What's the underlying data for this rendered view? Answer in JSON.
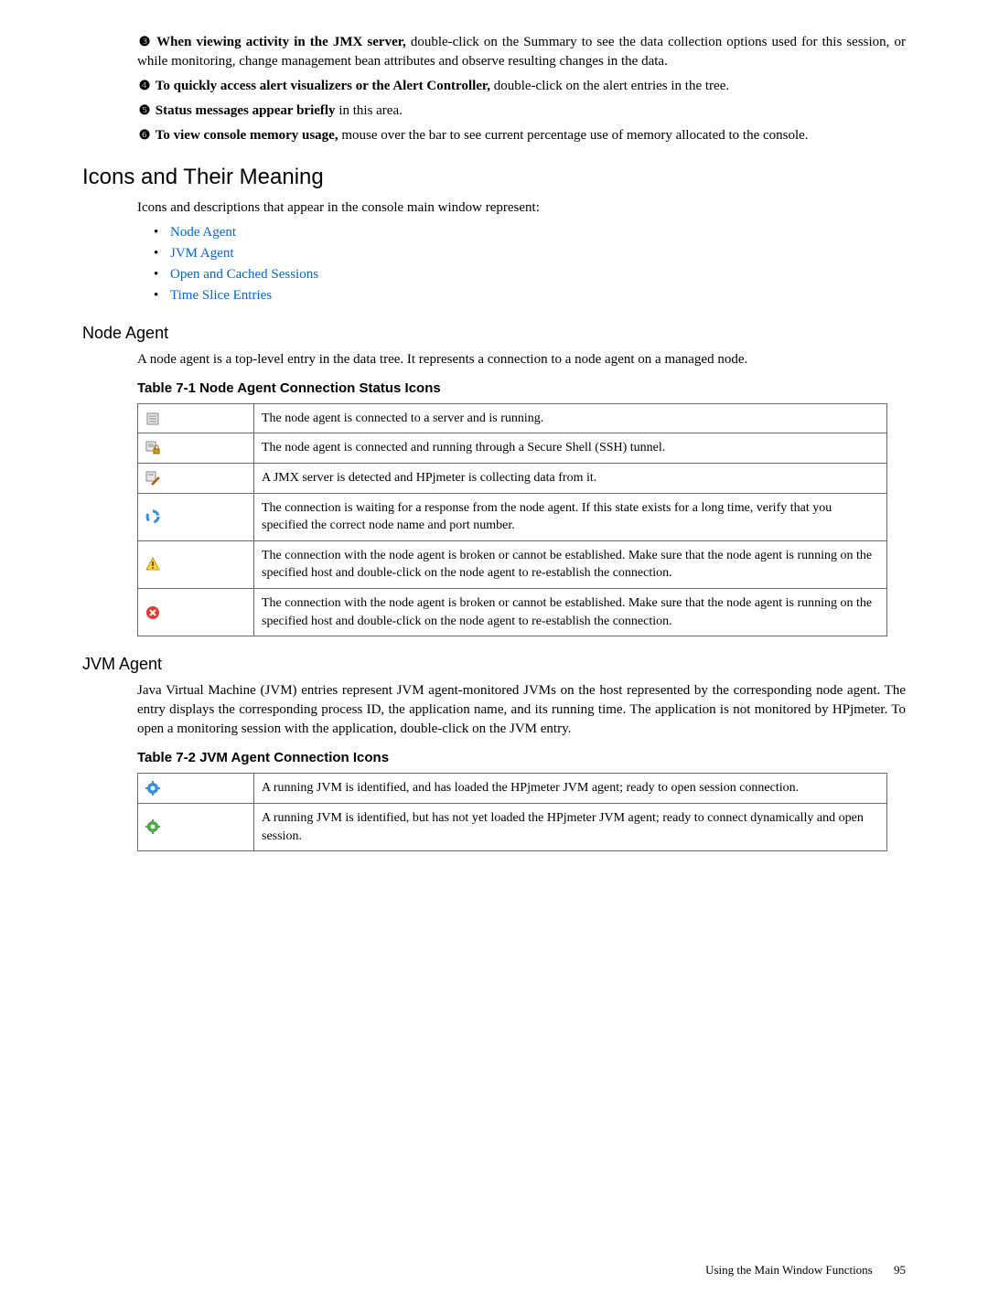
{
  "top_paragraphs": [
    {
      "marker": "❸",
      "lead_bold": "When viewing activity in the JMX server,",
      "rest": " double-click on the Summary to see the data collection options used for this session, or while monitoring, change management bean attributes and observe resulting changes in the data."
    },
    {
      "marker": "❹",
      "lead_bold": "To quickly access alert visualizers or the Alert Controller,",
      "rest": " double-click on the alert entries in the tree."
    },
    {
      "marker": "❺",
      "lead_bold": "Status messages appear briefly",
      "rest": " in this area."
    },
    {
      "marker": "❻",
      "lead_bold": "To view console memory usage,",
      "rest": "  mouse over the bar to see current percentage use of memory allocated to the console."
    }
  ],
  "section_icons": {
    "heading": "Icons and Their Meaning",
    "intro": "Icons and descriptions that appear in the console main window represent:",
    "bullets": [
      "Node Agent",
      "JVM Agent",
      "Open and Cached Sessions",
      "Time Slice Entries"
    ]
  },
  "node_agent": {
    "heading": "Node Agent",
    "intro": "A node agent is a top-level entry in the data tree. It represents a connection to a node agent on a managed node.",
    "table_title": "Table 7-1 Node Agent Connection Status Icons",
    "rows": [
      {
        "icon": "server",
        "desc": "The node agent is connected to a server and is running."
      },
      {
        "icon": "server-lock",
        "desc": "The node agent is connected and running through a Secure Shell (SSH) tunnel."
      },
      {
        "icon": "server-pencil",
        "desc": "A JMX server is detected and HPjmeter is collecting data from it."
      },
      {
        "icon": "spinner",
        "desc": "The connection is waiting for a response from the node agent. If this state exists for a long time, verify that you specified the correct node name and port number."
      },
      {
        "icon": "warning",
        "desc": "The connection with the node agent is broken or cannot be established. Make sure that the node agent is running on the specified host and double-click on the node agent to re-establish the connection."
      },
      {
        "icon": "error",
        "desc": "The connection with the node agent is broken or cannot be established. Make sure that the node agent is running on the specified host and double-click on the node agent to re-establish the connection."
      }
    ]
  },
  "jvm_agent": {
    "heading": "JVM Agent",
    "intro": "Java Virtual Machine (JVM) entries represent JVM agent-monitored JVMs on the host represented by the corresponding node agent. The entry displays the corresponding process ID, the application name, and its running time. The application is not monitored by HPjmeter. To open a monitoring session with the application, double-click on the JVM entry.",
    "table_title": "Table 7-2 JVM Agent Connection Icons",
    "rows": [
      {
        "icon": "gear-blue",
        "desc": "A running JVM is identified, and has loaded the HPjmeter JVM agent; ready to open session connection."
      },
      {
        "icon": "gear-green",
        "desc": "A running JVM is identified, but has not yet loaded the HPjmeter JVM agent; ready to connect dynamically and open session."
      }
    ]
  },
  "footer": {
    "text": "Using the Main Window Functions",
    "page": "95"
  }
}
